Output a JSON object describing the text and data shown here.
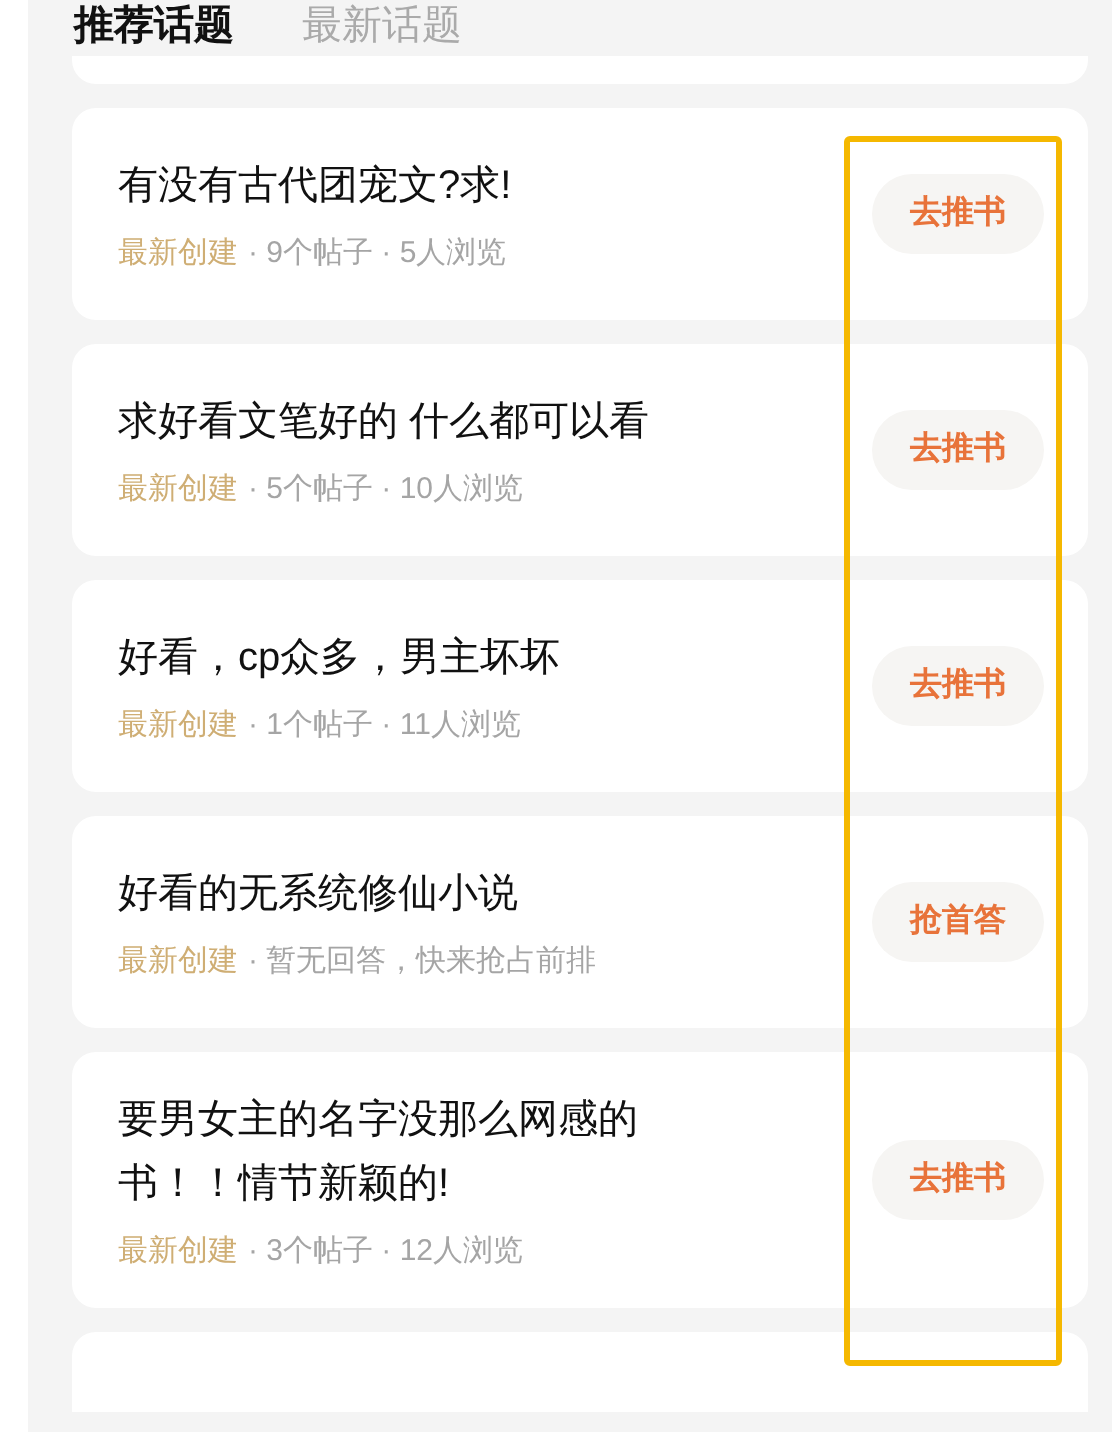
{
  "tabs": [
    {
      "label": "推荐话题",
      "selected": true
    },
    {
      "label": "最新话题",
      "selected": false
    }
  ],
  "topics": [
    {
      "title": "有没有古代团宠文?求!",
      "tag": "最新创建",
      "info": "· 9个帖子 · 5人浏览",
      "action": "去推书"
    },
    {
      "title": "求好看文笔好的 什么都可以看",
      "tag": "最新创建",
      "info": "· 5个帖子 · 10人浏览",
      "action": "去推书"
    },
    {
      "title": "好看，cp众多，男主坏坏",
      "tag": "最新创建",
      "info": "· 1个帖子 · 11人浏览",
      "action": "去推书"
    },
    {
      "title": "好看的无系统修仙小说",
      "tag": "最新创建",
      "info": "· 暂无回答，快来抢占前排",
      "action": "抢首答"
    },
    {
      "title": "要男女主的名字没那么网感的书！！情节新颖的!",
      "tag": "最新创建",
      "info": "· 3个帖子 · 12人浏览",
      "action": "去推书"
    }
  ]
}
